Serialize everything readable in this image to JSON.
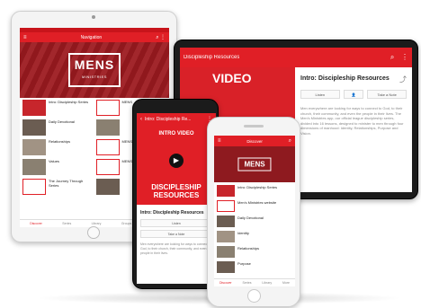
{
  "ipad": {
    "title": "Navigation",
    "hero_logo": "MENS",
    "hero_sub": "MINISTRIES",
    "items": [
      {
        "label": "Intro: Discipleship Series"
      },
      {
        "label": "MENS"
      },
      {
        "label": "Daily Devotional"
      },
      {
        "label": ""
      },
      {
        "label": "Relationships"
      },
      {
        "label": "MENS"
      },
      {
        "label": "Values"
      },
      {
        "label": "MENS"
      },
      {
        "label": "The Journey Through Series"
      },
      {
        "label": ""
      }
    ],
    "tabs": [
      "Discover",
      "Series",
      "Library",
      "Groups",
      "More"
    ]
  },
  "tablet": {
    "title": "Discipleship Resources",
    "video_text": "VIDEO",
    "detail_title": "Intro: Discipleship Resources",
    "listen_label": "Listen",
    "take_note_label": "Take a Note",
    "body": "Men everywhere are looking for ways to connect to God, to their church, their community, and even the people in their lives. The Men's Ministries app, our official league discipleship series, divided into 16 lessons, designed to minister to men through four dimensions of manhood: Identity, Relationships, Purpose and Vision."
  },
  "android": {
    "title": "Intro: Discipleship Re...",
    "intro_video": "INTRO VIDEO",
    "play": "▶",
    "video_title_line1": "DISCIPLESHIP",
    "video_title_line2": "RESOURCES",
    "detail_title": "Intro: Discipleship Resources",
    "listen_label": "Listen",
    "take_note_label": "Take a Note",
    "body": "Men everywhere are looking for ways to connect to God, to their church, their community, and even the people in their lives."
  },
  "iphone": {
    "title": "Discover",
    "hero_logo": "MENS",
    "items": [
      {
        "label": "Intro: Discipleship Series"
      },
      {
        "label": "Men's Ministries website"
      },
      {
        "label": "Daily Devotional"
      },
      {
        "label": "Identity"
      },
      {
        "label": "Relationships"
      },
      {
        "label": "Purpose"
      }
    ],
    "tabs": [
      "Discover",
      "Series",
      "Library",
      "More"
    ]
  },
  "icons": {
    "menu": "≡",
    "back": "‹",
    "search": "⌕",
    "more": "⋮",
    "share": "⤴"
  }
}
